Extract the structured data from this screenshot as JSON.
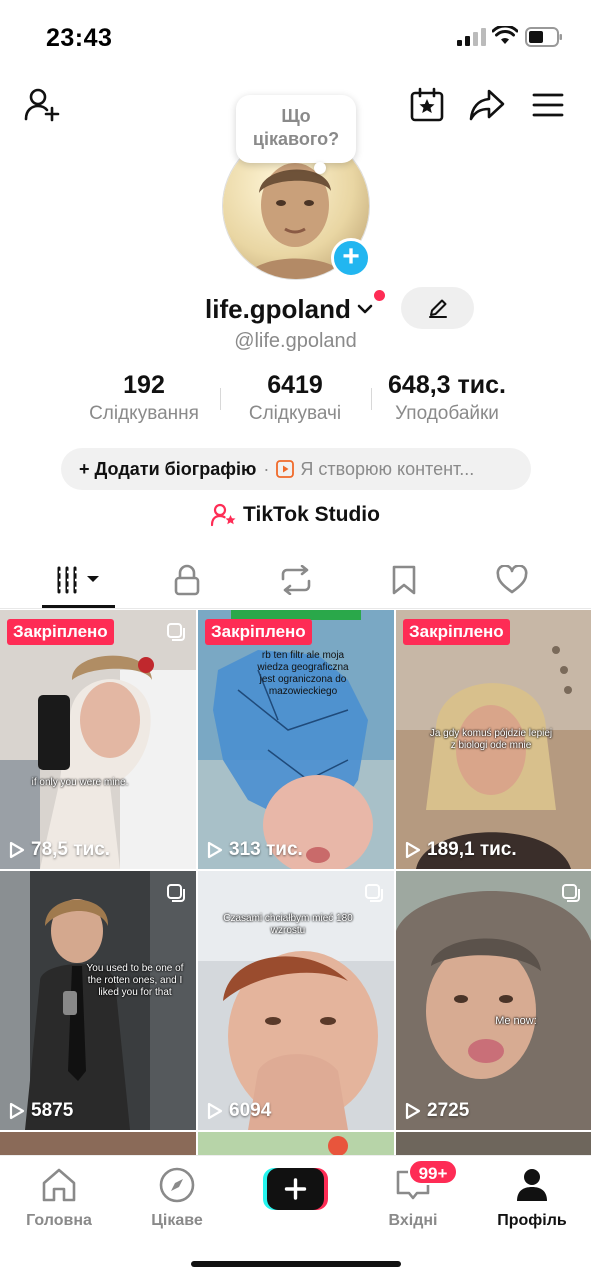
{
  "status_bar": {
    "time": "23:43"
  },
  "bubble": {
    "line1": "Що",
    "line2": "цікавого?"
  },
  "profile": {
    "username": "life.gpoland",
    "handle": "@life.gpoland"
  },
  "stats": [
    {
      "value": "192",
      "label": "Слідкування"
    },
    {
      "value": "6419",
      "label": "Слідкувачі"
    },
    {
      "value": "648,3 тис.",
      "label": "Уподобайки"
    }
  ],
  "bio": {
    "add_label": "+ Додати біографію",
    "separator": "·",
    "creator_label": "Я створюю контент..."
  },
  "studio_label": "TikTok Studio",
  "videos": [
    {
      "pinned_label": "Закріплено",
      "views": "78,5 тис.",
      "caption": "if only you were mine."
    },
    {
      "pinned_label": "Закріплено",
      "views": "313 тис.",
      "caption": "rb ten filtr ale moja wiedza geograficzna jest ograniczona do mazowieckiego"
    },
    {
      "pinned_label": "Закріплено",
      "views": "189,1 тис.",
      "caption": "Ja gdy komuś pójdzie lepiej z biologi ode mnie"
    },
    {
      "pinned_label": "",
      "views": "5875",
      "caption": "You used to be one of the rotten ones, and I liked you for that"
    },
    {
      "pinned_label": "",
      "views": "6094",
      "caption": "Czasami chciałbym mieć 180 wzrostu"
    },
    {
      "pinned_label": "",
      "views": "2725",
      "caption": "Me now:"
    }
  ],
  "nav": {
    "home": "Головна",
    "discover": "Цікаве",
    "inbox": "Вхідні",
    "inbox_badge": "99+",
    "profile": "Профіль"
  },
  "colors": {
    "accent": "#fe2c55",
    "avatar_plus": "#22b6f0",
    "muted_text": "#8a8a8a"
  }
}
